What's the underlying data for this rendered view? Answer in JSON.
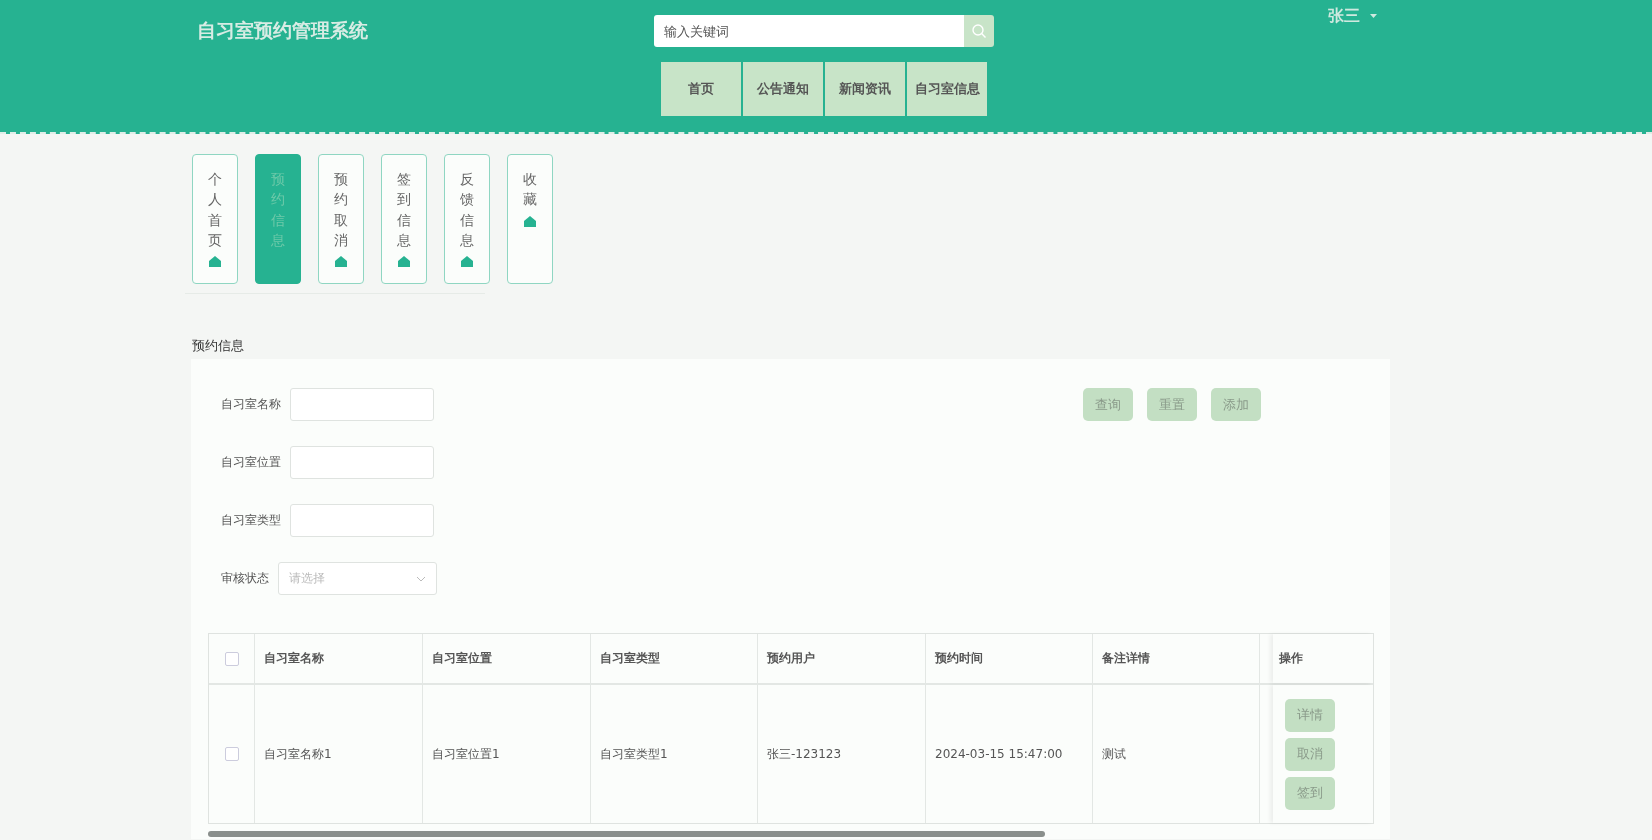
{
  "header": {
    "title": "自习室预约管理系统",
    "search": {
      "placeholder": "输入关键词"
    },
    "user": "张三",
    "nav": [
      {
        "label": "首页"
      },
      {
        "label": "公告通知"
      },
      {
        "label": "新闻资讯"
      },
      {
        "label": "自习室信息"
      }
    ]
  },
  "side_tabs": [
    {
      "label": "个人首页",
      "selected": false
    },
    {
      "label": "预约信息",
      "selected": true
    },
    {
      "label": "预约取消",
      "selected": false
    },
    {
      "label": "签到信息",
      "selected": false
    },
    {
      "label": "反馈信息",
      "selected": false
    },
    {
      "label": "收藏",
      "selected": false
    }
  ],
  "section_title": "预约信息",
  "filters": [
    {
      "label": "自习室名称",
      "kind": "text"
    },
    {
      "label": "自习室位置",
      "kind": "text"
    },
    {
      "label": "自习室类型",
      "kind": "text"
    },
    {
      "label": "审核状态",
      "kind": "select",
      "placeholder": "请选择"
    }
  ],
  "buttons": [
    "查询",
    "重置",
    "添加"
  ],
  "table": {
    "all_checked": false,
    "columns": [
      "自习室名称",
      "自习室位置",
      "自习室类型",
      "预约用户",
      "预约时间",
      "备注详情"
    ],
    "action_column": "操作",
    "rows": [
      {
        "checked": false,
        "cells": [
          "自习室名称1",
          "自习室位置1",
          "自习室类型1",
          "张三-123123",
          "2024-03-15 15:47:00",
          "测试"
        ],
        "actions": [
          "详情",
          "取消",
          "签到"
        ]
      }
    ]
  }
}
